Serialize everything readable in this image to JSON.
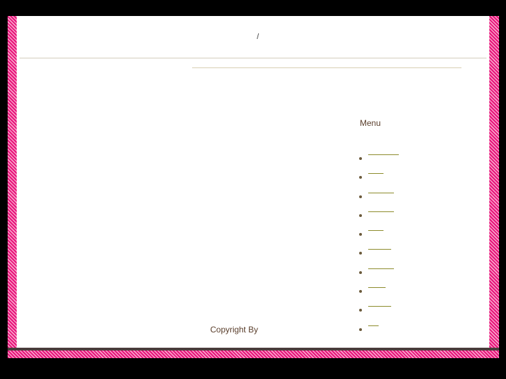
{
  "header": {
    "title": "/"
  },
  "sidebar": {
    "heading": "Menu",
    "items": [
      {
        "label": ""
      },
      {
        "label": ""
      },
      {
        "label": ""
      },
      {
        "label": ""
      },
      {
        "label": ""
      },
      {
        "label": ""
      },
      {
        "label": ""
      },
      {
        "label": ""
      },
      {
        "label": ""
      },
      {
        "label": ""
      }
    ]
  },
  "footer": {
    "copyright": "Copyright By"
  },
  "colors": {
    "frame_stripe": "#e8137a",
    "frame_stripe_light": "#f7a3c9",
    "text": "#5a3e2b",
    "link": "#8c8b2b"
  }
}
